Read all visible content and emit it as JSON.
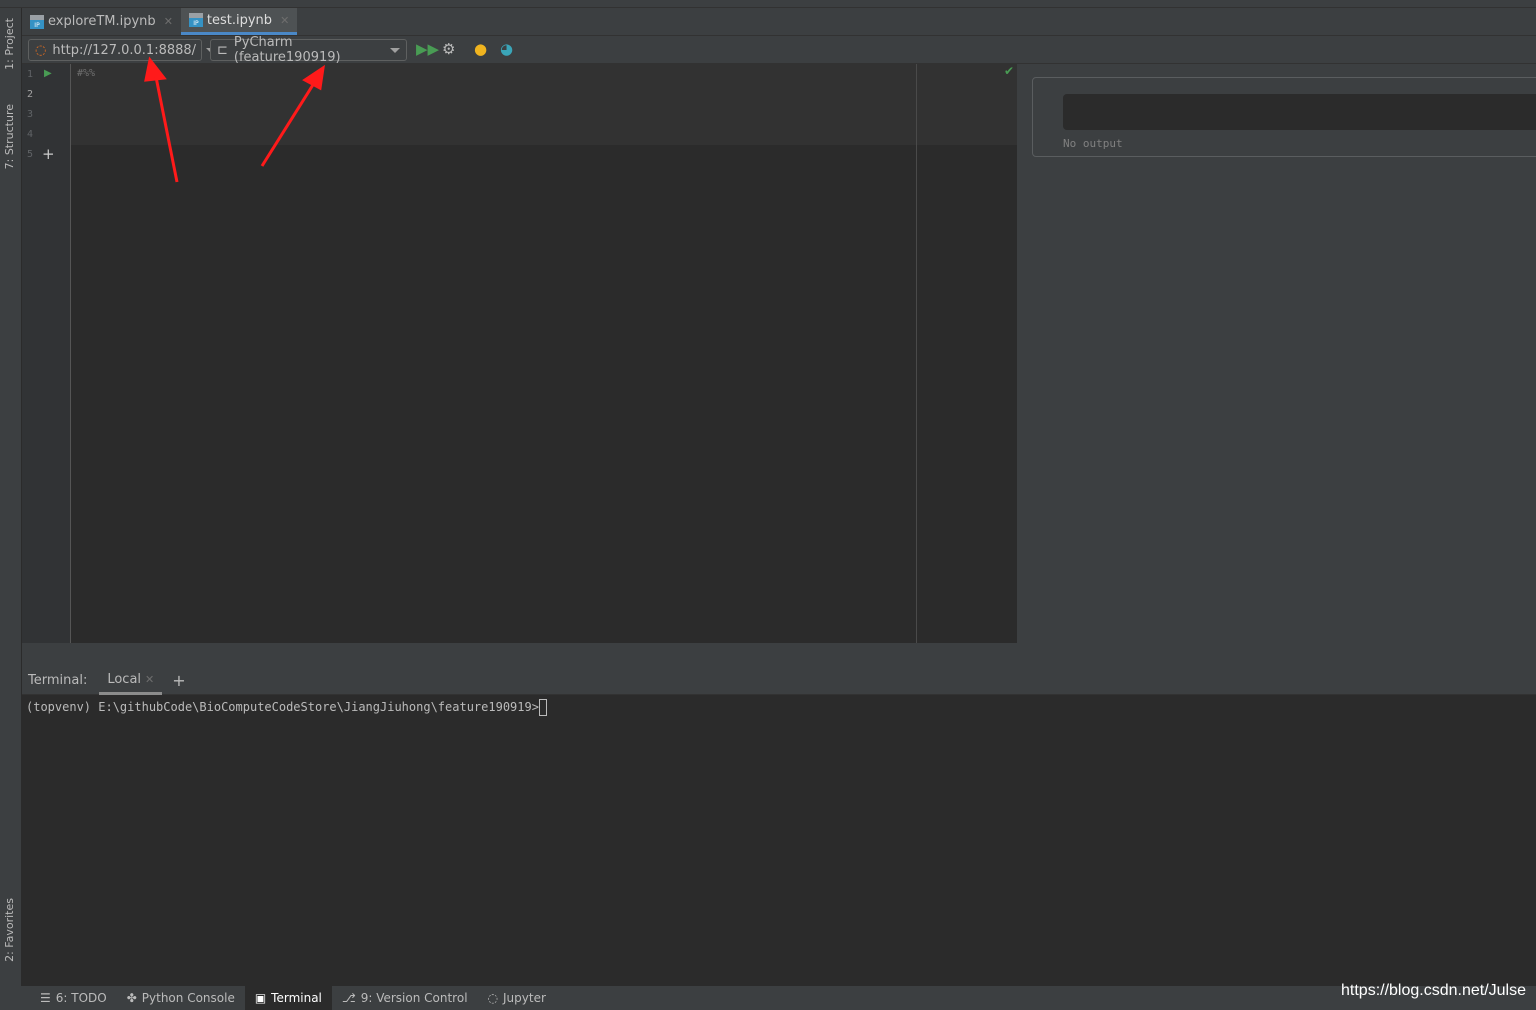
{
  "left_tool_windows": [
    "1: Project",
    "7: Structure",
    "2: Favorites"
  ],
  "tabs": [
    {
      "label": "exploreTM.ipynb",
      "active": false
    },
    {
      "label": "test.ipynb",
      "active": true
    }
  ],
  "toolbar": {
    "server_url": "http://127.0.0.1:8888/",
    "kernel": "PyCharm (feature190919)"
  },
  "editor": {
    "line_numbers": [
      "1",
      "2",
      "3",
      "4",
      "5"
    ],
    "code_line1": "#%%"
  },
  "output": {
    "text": "No output"
  },
  "terminal": {
    "label": "Terminal:",
    "tab": "Local",
    "prompt": "(topvenv) E:\\githubCode\\BioComputeCodeStore\\JiangJiuhong\\feature190919>"
  },
  "status_bar": [
    "6: TODO",
    "Python Console",
    "Terminal",
    "9: Version Control",
    "Jupyter"
  ],
  "watermark": "https://blog.csdn.net/Julse",
  "colors": {
    "accent": "#4a88c7",
    "run_green": "#499c54",
    "annotation_arrow": "#ff1a1a"
  }
}
